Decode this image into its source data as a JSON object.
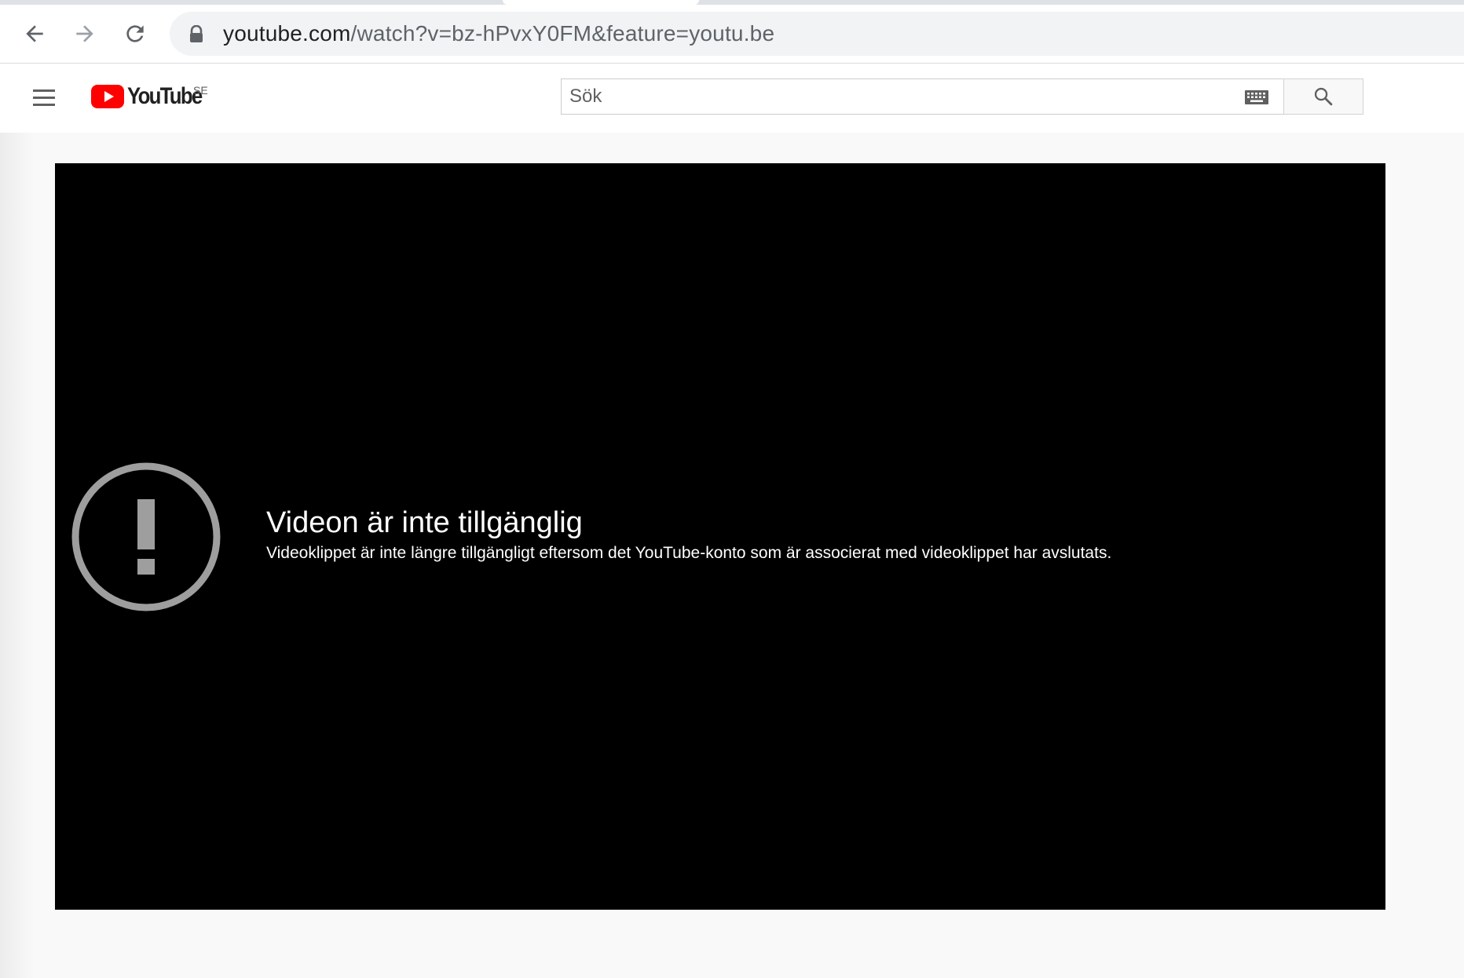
{
  "browser": {
    "url_domain": "youtube.com",
    "url_path": "/watch?v=bz-hPvxY0FM&feature=youtu.be",
    "icons": {
      "back": "arrow-left-icon",
      "forward": "arrow-right-icon",
      "reload": "reload-icon",
      "secure": "lock-icon"
    }
  },
  "header": {
    "logo_text": "YouTube",
    "country_code": "SE",
    "search_placeholder": "Sök",
    "brand_color": "#ff0000"
  },
  "player": {
    "error_title": "Videon är inte tillgänglig",
    "error_message": "Videoklippet är inte längre tillgängligt eftersom det YouTube-konto som är associerat med videoklippet har avslutats.",
    "icon": "exclamation-circle-icon",
    "icon_color": "#9e9e9e"
  }
}
